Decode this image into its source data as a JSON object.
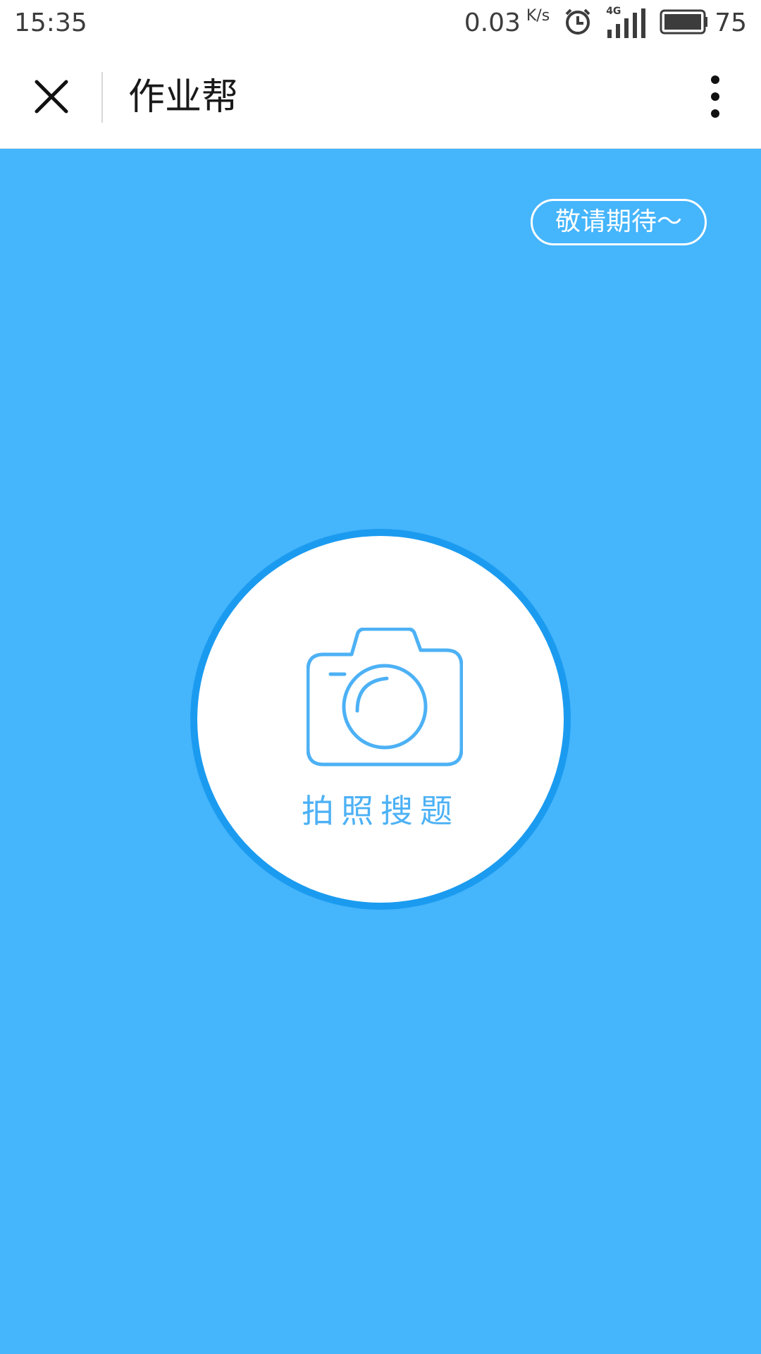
{
  "status_bar": {
    "time": "15:35",
    "net_speed": "0.03",
    "net_unit": "K/s",
    "network_type": "4G",
    "battery_level": "75",
    "icons": [
      "alarm-icon",
      "signal-4g-icon",
      "battery-icon"
    ]
  },
  "header": {
    "title": "作业帮",
    "close_icon": "close-icon",
    "more_icon": "more-vertical-icon"
  },
  "main": {
    "coming_soon_label": "敬请期待～",
    "photo_search_label": "拍照搜题",
    "camera_icon": "camera-icon",
    "colors": {
      "background": "#45b5fc",
      "circle_ring": "#1b9bf0",
      "accent": "#4db1f5"
    }
  }
}
